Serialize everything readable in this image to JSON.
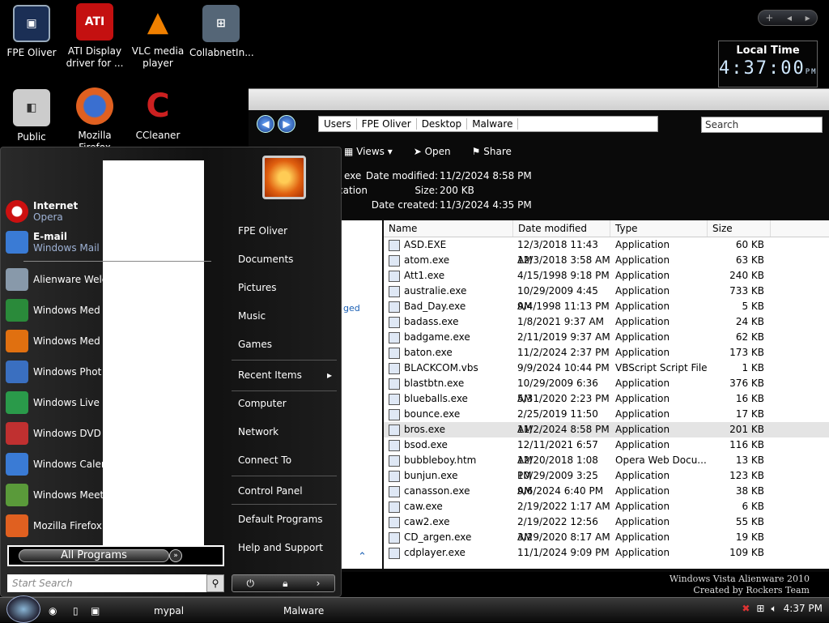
{
  "desktop": {
    "icons": [
      {
        "label": "FPE Oliver",
        "icon": "computer-icon",
        "color": "#1b2f55"
      },
      {
        "label": "ATI Display driver for ...",
        "icon": "ati-icon",
        "color": "#c41010"
      },
      {
        "label": "VLC media player",
        "icon": "vlc-icon",
        "color": "#f08000"
      },
      {
        "label": "CollabnetIn...",
        "icon": "network-icon",
        "color": "#667788"
      },
      {
        "label": "Public",
        "icon": "folder-icon",
        "color": "#cccccc"
      },
      {
        "label": "Mozilla Firefox",
        "icon": "firefox-icon",
        "color": "#e06020"
      },
      {
        "label": "CCleaner",
        "icon": "ccleaner-icon",
        "color": "#cc2020"
      }
    ]
  },
  "gadget": {
    "sidebar_plus": "+",
    "sidebar_prev": "◂",
    "sidebar_next": "▸",
    "clock_label": "Local Time",
    "clock_time": "4:37:00",
    "clock_ampm": "PM"
  },
  "explorer": {
    "crumbs": [
      "Users",
      "FPE Oliver",
      "Desktop",
      "Malware"
    ],
    "search": "Search",
    "toolbar": {
      "views": "Views",
      "open": "Open",
      "share": "Share"
    },
    "details": {
      "name_frag": "exe",
      "type_frag": "cation",
      "modified_label": "Date modified:",
      "modified": "11/2/2024 8:58 PM",
      "size_label": "Size:",
      "size": "200 KB",
      "created_label": "Date created:",
      "created": "11/3/2024 4:35 PM"
    },
    "side_frag": "ged",
    "columns": [
      "Name",
      "Date modified",
      "Type",
      "Size"
    ],
    "files": [
      {
        "name": "ASD.EXE",
        "date": "12/3/2018 11:43 AM",
        "type": "Application",
        "size": "60 KB"
      },
      {
        "name": "atom.exe",
        "date": "12/3/2018 3:58 AM",
        "type": "Application",
        "size": "63 KB"
      },
      {
        "name": "Att1.exe",
        "date": "4/15/1998 9:18 PM",
        "type": "Application",
        "size": "240 KB"
      },
      {
        "name": "australie.exe",
        "date": "10/29/2009 4:45 AM",
        "type": "Application",
        "size": "733 KB"
      },
      {
        "name": "Bad_Day.exe",
        "date": "9/4/1998 11:13 PM",
        "type": "Application",
        "size": "5 KB"
      },
      {
        "name": "badass.exe",
        "date": "1/8/2021 9:37 AM",
        "type": "Application",
        "size": "24 KB"
      },
      {
        "name": "badgame.exe",
        "date": "2/11/2019 9:37 AM",
        "type": "Application",
        "size": "62 KB"
      },
      {
        "name": "baton.exe",
        "date": "11/2/2024 2:37 PM",
        "type": "Application",
        "size": "173 KB"
      },
      {
        "name": "BLACKCOM.vbs",
        "date": "9/9/2024 10:44 PM",
        "type": "VBScript Script File",
        "size": "1 KB"
      },
      {
        "name": "blastbtn.exe",
        "date": "10/29/2009 6:36 AM",
        "type": "Application",
        "size": "376 KB"
      },
      {
        "name": "blueballs.exe",
        "date": "5/31/2020 2:23 PM",
        "type": "Application",
        "size": "16 KB"
      },
      {
        "name": "bounce.exe",
        "date": "2/25/2019 11:50 AM",
        "type": "Application",
        "size": "17 KB"
      },
      {
        "name": "bros.exe",
        "date": "11/2/2024 8:58 PM",
        "type": "Application",
        "size": "201 KB"
      },
      {
        "name": "bsod.exe",
        "date": "12/11/2021 6:57 AM",
        "type": "Application",
        "size": "116 KB"
      },
      {
        "name": "bubbleboy.htm",
        "date": "12/20/2018 1:08 PM",
        "type": "Opera Web Docu...",
        "size": "13 KB"
      },
      {
        "name": "bunjun.exe",
        "date": "10/29/2009 3:25 AM",
        "type": "Application",
        "size": "123 KB"
      },
      {
        "name": "canasson.exe",
        "date": "9/6/2024 6:40 PM",
        "type": "Application",
        "size": "38 KB"
      },
      {
        "name": "caw.exe",
        "date": "2/19/2022 1:17 AM",
        "type": "Application",
        "size": "6 KB"
      },
      {
        "name": "caw2.exe",
        "date": "2/19/2022 12:56 AM",
        "type": "Application",
        "size": "55 KB"
      },
      {
        "name": "CD_argen.exe",
        "date": "3/29/2020 8:17 AM",
        "type": "Application",
        "size": "19 KB"
      },
      {
        "name": "cdplayer.exe",
        "date": "11/1/2024 9:09 PM",
        "type": "Application",
        "size": "109 KB"
      }
    ]
  },
  "startmenu": {
    "pinned": [
      {
        "title": "Internet",
        "sub": "Opera",
        "color": "#cc1010"
      },
      {
        "title": "E-mail",
        "sub": "Windows Mail",
        "color": "#3a7bd5"
      }
    ],
    "recent": [
      {
        "label": "Alienware Welc",
        "color": "#8899aa"
      },
      {
        "label": "Windows Med",
        "color": "#2a8a3a"
      },
      {
        "label": "Windows Med",
        "color": "#e07010"
      },
      {
        "label": "Windows Phot",
        "color": "#3a6fc0"
      },
      {
        "label": "Windows Live",
        "color": "#2a9a4a"
      },
      {
        "label": "Windows DVD",
        "color": "#c03030"
      },
      {
        "label": "Windows Caler",
        "color": "#3a7bd5"
      },
      {
        "label": "Windows Meet",
        "color": "#5a9a3a"
      },
      {
        "label": "Mozilla Firefox",
        "color": "#e06020"
      }
    ],
    "right": [
      "FPE Oliver",
      "Documents",
      "Pictures",
      "Music",
      "Games",
      "Recent Items",
      "Computer",
      "Network",
      "Connect To",
      "Control Panel",
      "Default Programs",
      "Help and Support"
    ],
    "all_programs": "All Programs",
    "search_placeholder": "Start Search"
  },
  "taskbar": {
    "buttons": [
      "mypal",
      "Malware"
    ],
    "time": "4:37 PM"
  },
  "watermark": {
    "line1": "Windows Vista Alienware 2010",
    "line2": "Created by Rockers Team"
  }
}
